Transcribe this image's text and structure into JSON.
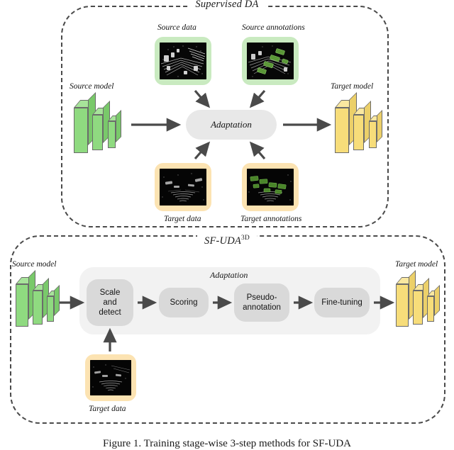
{
  "figure": {
    "caption": "Figure 1.   Training stage-wise 3-step methods for SF-UDA"
  },
  "panels": [
    {
      "id": "supervised-da",
      "title": "Supervised DA",
      "title_sup": "",
      "labels": {
        "source_model": "Source model",
        "target_model": "Target model",
        "source_data": "Source data",
        "source_annotations": "Source annotations",
        "target_data": "Target data",
        "target_annotations": "Target annotations",
        "adaptation": "Adaptation"
      }
    },
    {
      "id": "sf-uda-3d",
      "title": "SF-UDA",
      "title_sup": "3D",
      "labels": {
        "source_model": "Source model",
        "target_model": "Target model",
        "target_data": "Target data",
        "adaptation": "Adaptation"
      },
      "pipeline": [
        {
          "label": "Scale\nand\ndetect",
          "line1": "Scale",
          "line2": "and",
          "line3": "detect"
        },
        {
          "label": "Scoring",
          "line1": "Scoring",
          "line2": "",
          "line3": ""
        },
        {
          "label": "Pseudo-annotation",
          "line1": "Pseudo-",
          "line2": "annotation",
          "line3": ""
        },
        {
          "label": "Fine-tuning",
          "line1": "Fine-tuning",
          "line2": "",
          "line3": ""
        }
      ]
    }
  ],
  "colors": {
    "source_chip_bg": "#c9eac0",
    "target_chip_bg": "#fce3b2",
    "source_model_fill": "#8fda80",
    "target_model_fill": "#f7dd7a",
    "process_box_bg": "#d9d9d9",
    "adaptation_bg": "#e8e8e8",
    "adaptation_shell_bg": "#f2f2f2",
    "panel_border": "#4a4a4a",
    "arrow": "#4a4a4a",
    "thumbnail_bg": "#050505"
  }
}
